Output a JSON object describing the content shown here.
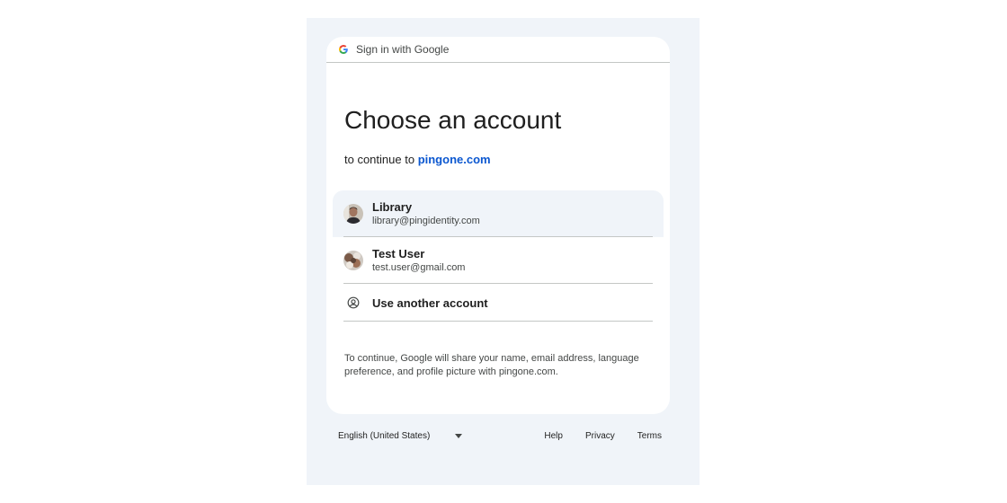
{
  "header": {
    "title": "Sign in with Google"
  },
  "page": {
    "title": "Choose an account",
    "subtitle_prefix": "to continue to",
    "subtitle_link": "pingone.com"
  },
  "accounts": [
    {
      "name": "Library",
      "email": "library@pingidentity.com"
    },
    {
      "name": "Test User",
      "email": "test.user@gmail.com"
    }
  ],
  "other_account": {
    "label": "Use another account",
    "icon": "account-circle-icon"
  },
  "disclaimer": "To continue, Google will share your name, email address, language preference, and profile picture with pingone.com.",
  "footer": {
    "language": "English (United States)",
    "links": [
      "Help",
      "Privacy",
      "Terms"
    ]
  },
  "colors": {
    "link": "#0b57d0",
    "background": "#f0f4f9"
  }
}
